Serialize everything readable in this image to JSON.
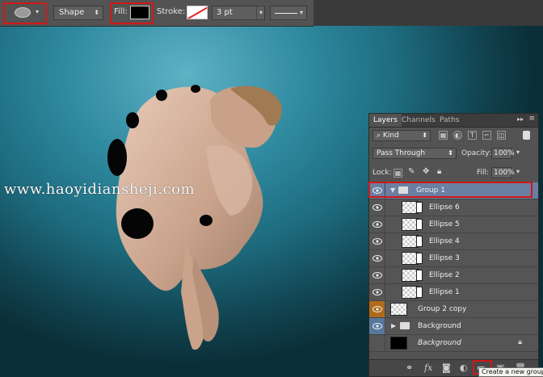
{
  "options_bar": {
    "shape_tool_icon": "ellipse-icon",
    "mode_value": "Shape",
    "fill_label": "Fill:",
    "fill_color": "#000000",
    "stroke_label": "Stroke:",
    "stroke_size_value": "3 pt"
  },
  "canvas": {
    "watermark": "www.haoyidiansheji.com"
  },
  "layers_panel": {
    "tabs": [
      "Layers",
      "Channels",
      "Paths"
    ],
    "kind_label": "Kind",
    "blend_mode": "Pass Through",
    "opacity_label": "Opacity:",
    "opacity_value": "100%",
    "lock_label": "Lock:",
    "fill_label": "Fill:",
    "fill_value": "100%",
    "layers": [
      {
        "name": "Group 1",
        "type": "group-open",
        "selected": true
      },
      {
        "name": "Ellipse 6",
        "type": "shape"
      },
      {
        "name": "Ellipse 5",
        "type": "shape"
      },
      {
        "name": "Ellipse 4",
        "type": "shape"
      },
      {
        "name": "Ellipse 3",
        "type": "shape"
      },
      {
        "name": "Ellipse 2",
        "type": "shape"
      },
      {
        "name": "Ellipse 1",
        "type": "shape"
      },
      {
        "name": "Group 2 copy",
        "type": "pixel"
      },
      {
        "name": "Background",
        "type": "group-closed"
      },
      {
        "name": "Background",
        "type": "locked-background"
      }
    ],
    "tooltip": "Create a new group"
  },
  "colors": {
    "highlight_red": "#d01818",
    "selected_layer": "#6a7fa2",
    "panel_bg": "#535353"
  }
}
